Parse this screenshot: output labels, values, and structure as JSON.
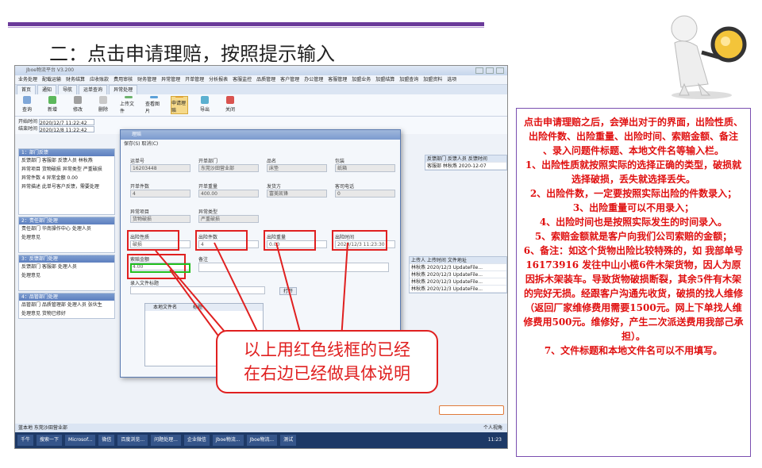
{
  "slide": {
    "title": "二：点击申请理赔，按照提示输入",
    "callout": [
      "以上用红色线框的已经",
      "在右边已经做具体说明"
    ],
    "notes": [
      "点击申请理赔之后，会弹出对于的界面，出险性质、出险件数、出险重量、出险时间、索赔金额、备注 、录入问题件标题、本地文件名等输入栏。",
      "1、出险性质就按照实际的选择正确的类型，破损就选择破损，丢失就选择丢失。",
      "2、出险件数，一定要按照实际出险的件数录入；",
      "3、出险重量可以不用录入；",
      "4、出险时间也是按照实际发生的时间录入。",
      "5、索赔金额就是客户向我们公司索赔的金额；",
      "6、备注：如这个货物出险比较特殊的，如 我部单号16173916 发往中山小榄6件木架货物，因人为原因拆木架装车。导致货物破损断裂，其余5件有木架的完好无损。经跟客户沟通先收货，破损的找人维修（返回厂家维修费用需要1500元。网上下单找人维修费用500元。维修好，产生二次派送费用我部己承担）。",
      "7、文件标题和本地文件名可以不用填写。"
    ]
  },
  "app": {
    "title": "Jboe物流平台 V3.200",
    "menu": [
      "业务处理",
      "配载运输",
      "财务结算",
      "应收账款",
      "费用审核",
      "财务管理",
      "异常管理",
      "开单管理",
      "分析报表",
      "客服监控",
      "品质管理",
      "客户管理",
      "办公管理",
      "客服管理",
      "加盟业务",
      "加盟结算",
      "加盟查询",
      "加盟资料",
      "选项"
    ],
    "tabs": [
      "首页",
      "通知",
      "导航",
      "运单查询",
      "异常处理"
    ],
    "toolbar": [
      "查询",
      "新增",
      "修改",
      "删除",
      "上传文件",
      "查看图片",
      "申请理赔",
      "导出",
      "关闭"
    ],
    "filters": {
      "start_label": "开始时间",
      "start_value": "2020/12/7 11:22:42",
      "end_label": "结束时间",
      "end_value": "2020/12/8 11:22:42"
    },
    "sections": [
      {
        "title": "1：部门反馈",
        "rows": [
          "反馈部门  客服部    反馈人员  林秋燕",
          "异常项目  货物破损    异常类型  严重破损",
          "异常件数  4    异常金额  0.00",
          "异常描述  此单号客户反馈，需要处理"
        ]
      },
      {
        "title": "2：责任部门处理",
        "rows": [
          "责任部门  华南操作中心    处理人员",
          "处理意见"
        ]
      },
      {
        "title": "3：反馈部门处理",
        "rows": [
          "反馈部门  客服部    处理人员",
          "处理意见"
        ]
      },
      {
        "title": "4：品管部门处理",
        "rows": [
          "品管部门  品质管理部    处理人员  张伙生",
          "处理意见  货物已修好"
        ]
      }
    ],
    "grid_right": [
      "反馈部门  反馈人员  反馈时间",
      "客服部  林秋燕  2020-12-07"
    ],
    "grid_files": [
      "上传人  上传时间  文件地址",
      "林秋燕  2020/12/3  UpdateFile...",
      "林秋燕  2020/12/3  UpdateFile...",
      "林秋燕  2020/12/3  UpdateFile...",
      "林秋燕  2020/12/3  UpdateFile..."
    ],
    "status": "蓝本地  东莞沙田营业部",
    "status_right": "个人视角",
    "taskbar": [
      "千牛",
      "搜索一下",
      "Microsof...",
      "微信",
      "百度浏览...",
      "问题处理...",
      "企业微信",
      "Jboe物流...",
      "Jboe物流...",
      "测试"
    ],
    "clock": "11:23"
  },
  "dialog": {
    "title": "理赔",
    "actions": "保存(S)    取消(C)",
    "fields": [
      {
        "label": "运单号",
        "value": "16203448"
      },
      {
        "label": "开单部门",
        "value": "东莞沙田营业部"
      },
      {
        "label": "品名",
        "value": "床垫"
      },
      {
        "label": "包装",
        "value": "纸箱"
      },
      {
        "label": "开单件数",
        "value": "4"
      },
      {
        "label": "开单重量",
        "value": "400.00"
      },
      {
        "label": "发货方",
        "value": "富美凯锋"
      },
      {
        "label": "客司电话",
        "value": "0"
      },
      {
        "label": "异常项目",
        "value": "货物破损"
      },
      {
        "label": "异常类型",
        "value": "严重破损"
      }
    ],
    "input_fields": [
      {
        "label": "出险性质",
        "value": "破损"
      },
      {
        "label": "出险件数",
        "value": "4"
      },
      {
        "label": "出险重量",
        "value": "0.00"
      },
      {
        "label": "出险时间",
        "value": "2020/12/3 11:23:30"
      }
    ],
    "claim_label": "索赔金额",
    "claim_value": "4.00",
    "remark_label": "备注",
    "file_label": "录入文件标题",
    "open_btn": "打开",
    "file_cols": [
      "本地文件名",
      "标题"
    ]
  }
}
